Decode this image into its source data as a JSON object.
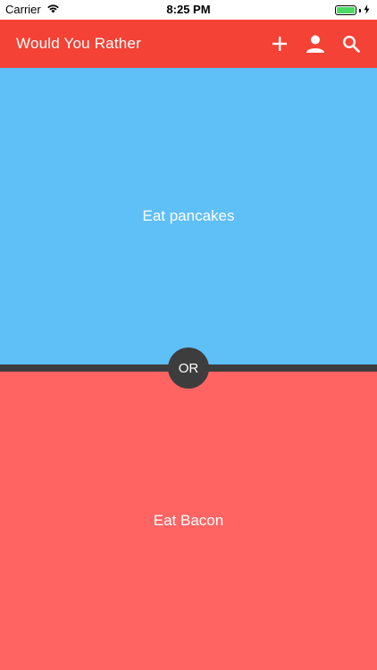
{
  "status_bar": {
    "carrier": "Carrier",
    "time": "8:25 PM",
    "icons": [
      "wifi-icon",
      "battery-icon",
      "charging-bolt-icon"
    ],
    "battery_color": "#4cd964"
  },
  "app_bar": {
    "title": "Would You Rather",
    "background": "#f44236",
    "actions": [
      {
        "name": "add-icon"
      },
      {
        "name": "person-icon"
      },
      {
        "name": "search-icon"
      }
    ]
  },
  "question": {
    "option_a": {
      "label": "Eat pancakes",
      "color": "#5fbff7"
    },
    "divider_label": "OR",
    "option_b": {
      "label": "Eat Bacon",
      "color": "#ff6462"
    },
    "divider_color": "#3d3d3d"
  }
}
